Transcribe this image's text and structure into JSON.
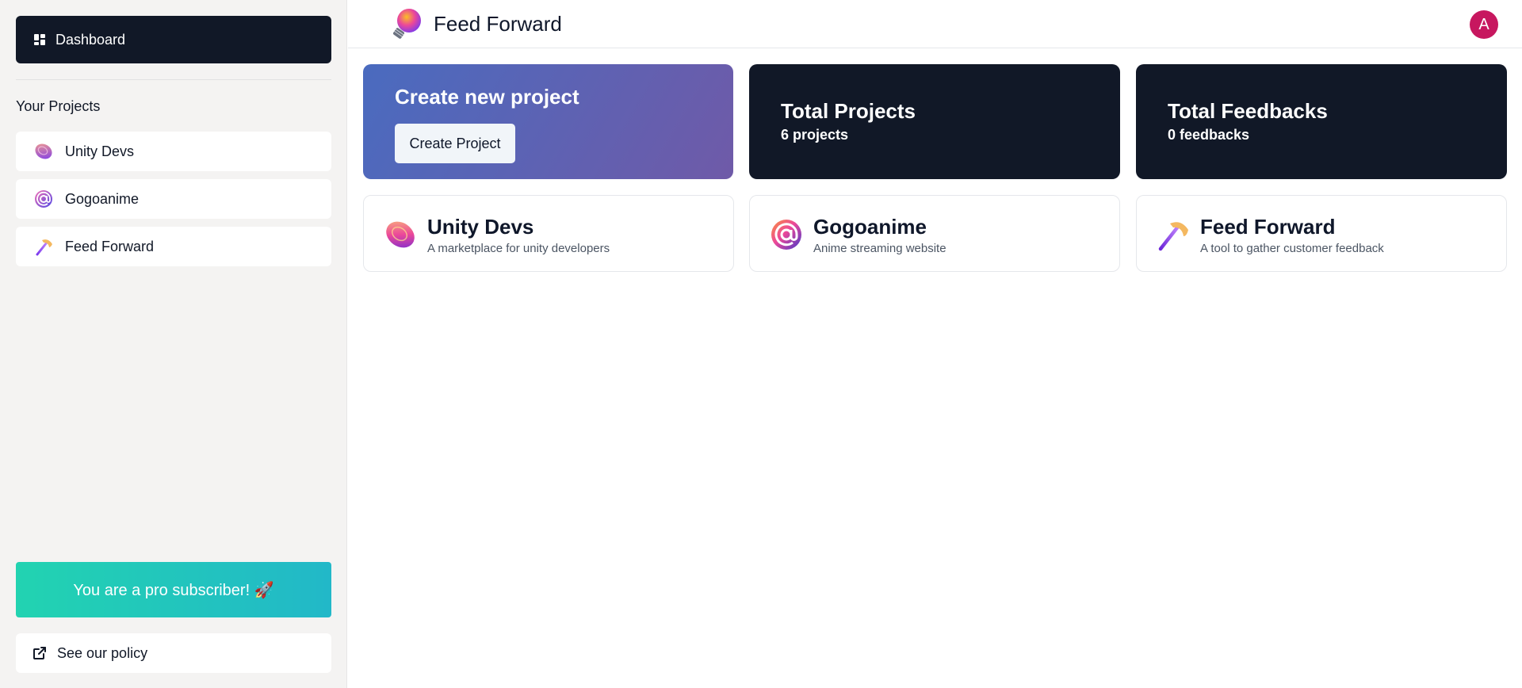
{
  "sidebar": {
    "dashboard_label": "Dashboard",
    "section_title": "Your Projects",
    "projects": [
      {
        "label": "Unity Devs",
        "icon": "coin-icon"
      },
      {
        "label": "Gogoanime",
        "icon": "at-sign-icon"
      },
      {
        "label": "Feed Forward",
        "icon": "pickaxe-icon"
      }
    ],
    "pro_banner": "You are a pro subscriber! 🚀",
    "policy_label": "See our policy"
  },
  "header": {
    "app_title": "Feed Forward",
    "avatar_initial": "A"
  },
  "create_card": {
    "heading": "Create new project",
    "button_label": "Create Project"
  },
  "stats": {
    "total_projects_label": "Total Projects",
    "total_projects_value": "6 projects",
    "total_feedbacks_label": "Total Feedbacks",
    "total_feedbacks_value": "0 feedbacks"
  },
  "project_cards": [
    {
      "name": "Unity Devs",
      "description": "A marketplace for unity developers",
      "icon": "coin-icon"
    },
    {
      "name": "Gogoanime",
      "description": "Anime streaming website",
      "icon": "at-sign-icon"
    },
    {
      "name": "Feed Forward",
      "description": "A tool to gather customer feedback",
      "icon": "pickaxe-icon"
    }
  ],
  "colors": {
    "dark": "#111827",
    "avatar": "#c7175f",
    "pro_gradient_start": "#22d3b1",
    "pro_gradient_end": "#22b8c8",
    "create_gradient_start": "#4a6bbf",
    "create_gradient_end": "#6f5aa8"
  }
}
